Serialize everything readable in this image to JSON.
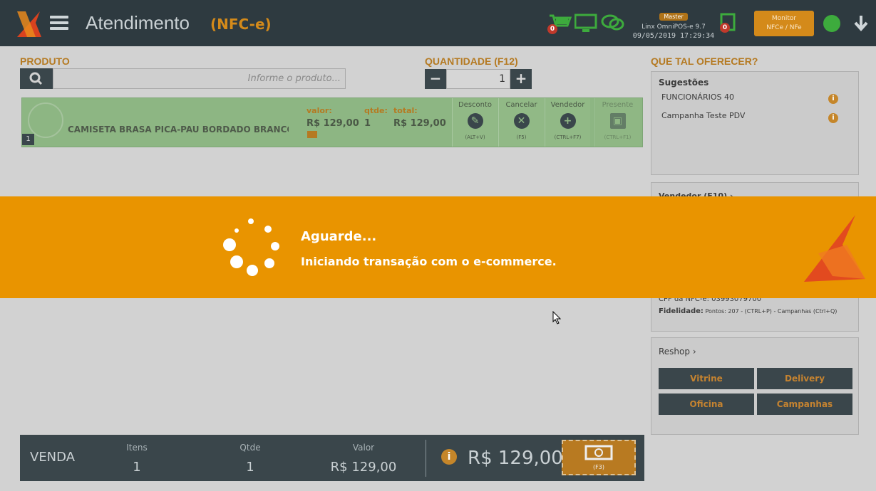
{
  "header": {
    "title": "Atendimento",
    "subtitle": "(NFC-e)",
    "cart_badge": "0",
    "tax_badge": "0",
    "master_badge": "Master",
    "system_name": "Linx OmniPOS-e  9.7",
    "datetime": "09/05/2019 17:29:34",
    "monitor_line1": "Monitor",
    "monitor_line2": "NFCe / NFe"
  },
  "product": {
    "label": "PRODUTO",
    "search_placeholder": "Informe o produto..."
  },
  "quantity": {
    "label": "QUANTIDADE (F12)",
    "minus": "−",
    "plus": "+",
    "value": "1"
  },
  "item": {
    "index": "1",
    "name": "CAMISETA BRASA PICA-PAU BORDADO BRANCO",
    "valor_label": "valor:",
    "valor": "R$ 129,00",
    "qtde_label": "qtde:",
    "qtde": "1",
    "total_label": "total:",
    "total": "R$ 129,00",
    "actions": [
      {
        "title": "Desconto",
        "key": "(ALT+V)"
      },
      {
        "title": "Cancelar",
        "key": "(F5)"
      },
      {
        "title": "Vendedor",
        "key": "(CTRL+F7)"
      },
      {
        "title": "Presente",
        "key": "(CTRL+F1)"
      }
    ]
  },
  "sidebar": {
    "offer_label": "QUE TAL OFERECER?",
    "suggestions_title": "Sugestões",
    "suggestions": [
      "FUNCIONÁRIOS 40",
      "Campanha Teste PDV"
    ],
    "vendedor_title": "Vendedor (F10) ›",
    "cpf_text": "CPF da NFC-e: 03993079700",
    "fidelidade_label": "Fidelidade:",
    "fidelidade_text": "Pontos: 207 - (CTRL+P) - Campanhas (Ctrl+Q)",
    "reshop_title": "Reshop ›",
    "reshop_buttons": [
      "Vitrine",
      "Delivery",
      "Oficina",
      "Campanhas"
    ]
  },
  "footer": {
    "venda": "VENDA",
    "itens_label": "Itens",
    "itens": "1",
    "qtde_label": "Qtde",
    "qtde": "1",
    "valor_label": "Valor",
    "valor": "R$ 129,00",
    "total": "R$ 129,00",
    "pay_key": "(F3)"
  },
  "banner": {
    "title": "Aguarde...",
    "message": "Iniciando transação com o e-commerce."
  },
  "colors": {
    "header_bg": "#2e3a40",
    "accent_orange": "#e99400",
    "item_green": "#8db683",
    "dark_panel": "#3a464b"
  }
}
